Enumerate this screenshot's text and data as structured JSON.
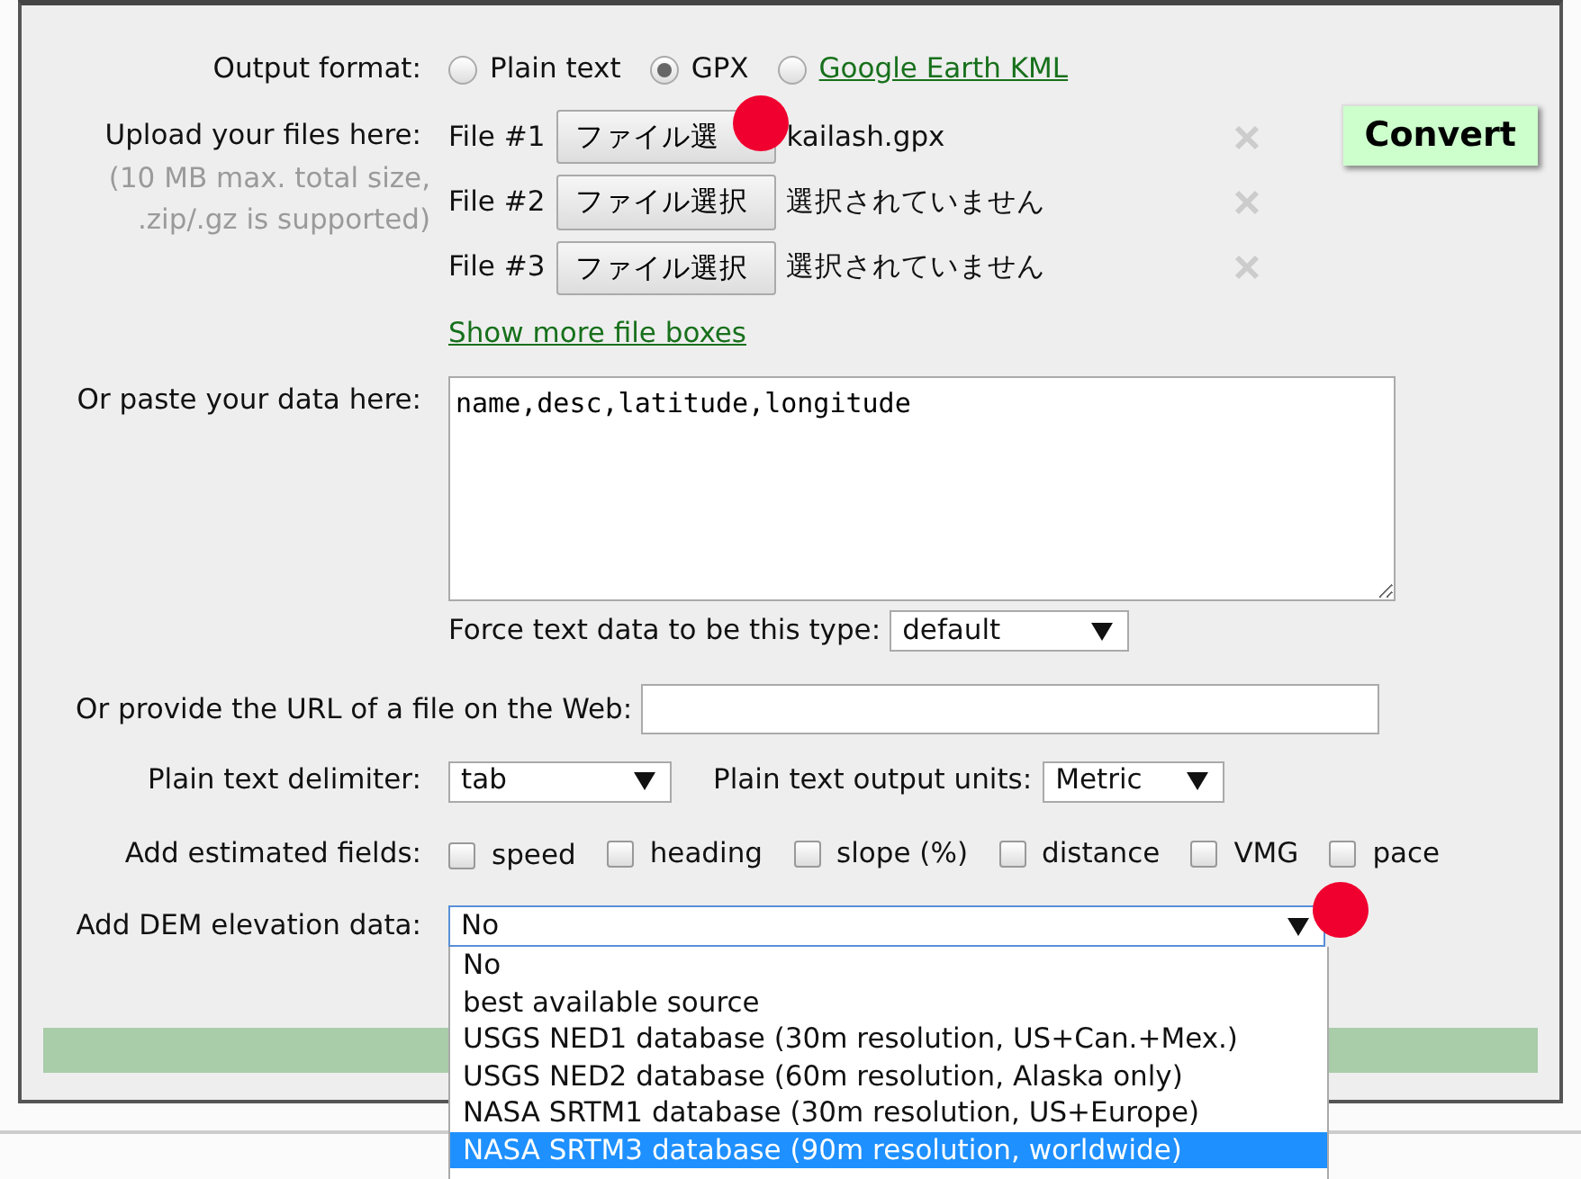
{
  "output_format": {
    "label": "Output format:",
    "options": [
      {
        "label": "Plain text",
        "selected": false,
        "kind": "text"
      },
      {
        "label": "GPX",
        "selected": true,
        "kind": "text"
      },
      {
        "label": "Google Earth KML",
        "selected": false,
        "kind": "link"
      }
    ]
  },
  "upload": {
    "label": "Upload your files here:",
    "note": "(10 MB max. total size, .zip/.gz is supported)",
    "files": [
      {
        "label": "File #1",
        "button": "ファイル選",
        "status": "kailash.gpx"
      },
      {
        "label": "File #2",
        "button": "ファイル選択",
        "status": "選択されていません"
      },
      {
        "label": "File #3",
        "button": "ファイル選択",
        "status": "選択されていません"
      }
    ],
    "more_link": "Show more file boxes",
    "convert_button": "Convert"
  },
  "paste": {
    "label": "Or paste your data here:",
    "value": "name,desc,latitude,longitude",
    "force_label": "Force text data to be this type:",
    "force_value": "default"
  },
  "url": {
    "label": "Or provide the URL of a file on the Web:"
  },
  "delimiter": {
    "label": "Plain text delimiter:",
    "value": "tab",
    "units_label": "Plain text output units:",
    "units_value": "Metric"
  },
  "estimated": {
    "label": "Add estimated fields:",
    "fields": [
      {
        "label": "speed",
        "checked": false
      },
      {
        "label": "heading",
        "checked": false
      },
      {
        "label": "slope (%)",
        "checked": false
      },
      {
        "label": "distance",
        "checked": false
      },
      {
        "label": "VMG",
        "checked": false
      },
      {
        "label": "pace",
        "checked": false
      }
    ]
  },
  "dem": {
    "label": "Add DEM elevation data:",
    "value": "No",
    "expanded": true,
    "options": [
      {
        "label": "No",
        "highlighted": false
      },
      {
        "label": "best available source",
        "highlighted": false
      },
      {
        "label": "USGS NED1 database (30m resolution, US+Can.+Mex.)",
        "highlighted": false
      },
      {
        "label": "USGS NED2 database (60m resolution, Alaska only)",
        "highlighted": false
      },
      {
        "label": "NASA SRTM1 database (30m resolution, US+Europe)",
        "highlighted": false
      },
      {
        "label": "NASA SRTM3 database (90m resolution, worldwide)",
        "highlighted": true
      }
    ]
  }
}
